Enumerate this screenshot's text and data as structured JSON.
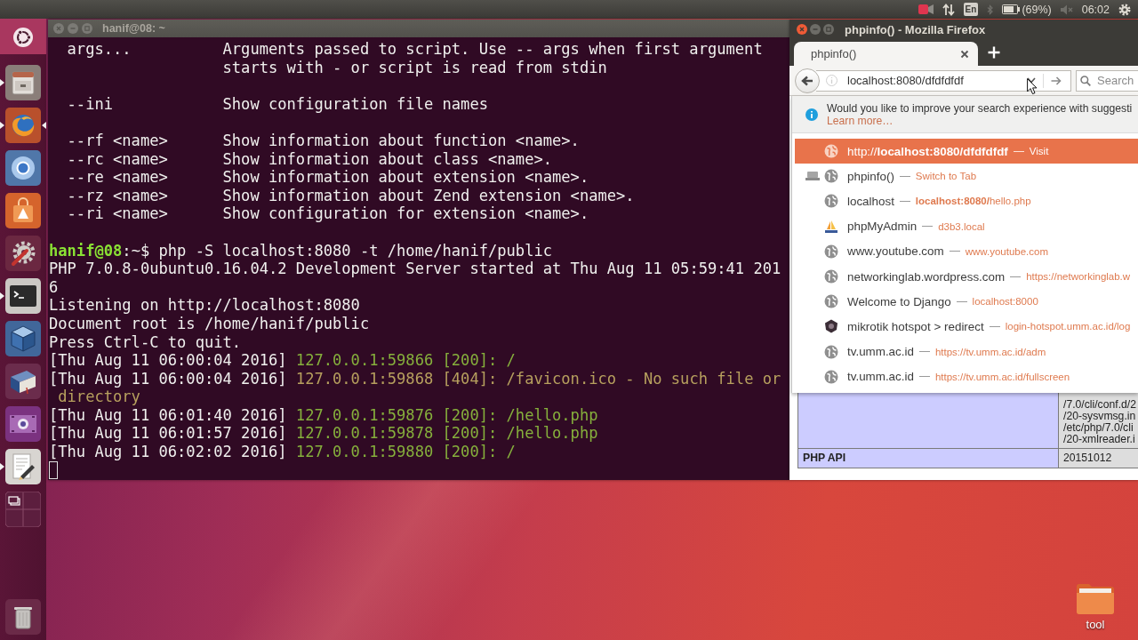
{
  "top_panel": {
    "keyboard_layout": "En",
    "battery": "(69%)",
    "clock": "06:02"
  },
  "launcher": {
    "apps": [
      {
        "running": true,
        "focused": false
      },
      {
        "running": true,
        "focused": true
      },
      {
        "running": false,
        "focused": false
      },
      {
        "running": false,
        "focused": false
      },
      {
        "running": false,
        "focused": false
      },
      {
        "running": true,
        "focused": false
      },
      {
        "running": false,
        "focused": false
      },
      {
        "running": false,
        "focused": false
      },
      {
        "running": false,
        "focused": false
      },
      {
        "running": true,
        "focused": false
      },
      {
        "running": false,
        "focused": false
      }
    ]
  },
  "terminal": {
    "title": "hanif@08: ~",
    "help_sections": [
      {
        "options": [
          {
            "option": "args...",
            "description": [
              "Arguments passed to script. Use -- args when first argument",
              "starts with - or script is read from stdin"
            ]
          }
        ]
      },
      {
        "options": [
          {
            "option": "--ini",
            "description": [
              "Show configuration file names"
            ]
          }
        ]
      },
      {
        "options": [
          {
            "option": "--rf <name>",
            "description": [
              "Show information about function <name>."
            ]
          },
          {
            "option": "--rc <name>",
            "description": [
              "Show information about class <name>."
            ]
          },
          {
            "option": "--re <name>",
            "description": [
              "Show information about extension <name>."
            ]
          },
          {
            "option": "--rz <name>",
            "description": [
              "Show information about Zend extension <name>."
            ]
          },
          {
            "option": "--ri <name>",
            "description": [
              "Show configuration for extension <name>."
            ]
          }
        ]
      }
    ],
    "session": [
      {
        "kind": "prompt",
        "user": "hanif@08",
        "path": ":~$",
        "command": "php -S localhost:8080 -t /home/hanif/public"
      },
      {
        "kind": "text",
        "text": "PHP 7.0.8-0ubuntu0.16.04.2 Development Server started at Thu Aug 11 05:59:41 201"
      },
      {
        "kind": "text",
        "text": "6"
      },
      {
        "kind": "text",
        "text": "Listening on http://localhost:8080"
      },
      {
        "kind": "text",
        "text": "Document root is /home/hanif/public"
      },
      {
        "kind": "text",
        "text": "Press Ctrl-C to quit."
      },
      {
        "kind": "log",
        "time": "[Thu Aug 11 06:00:04 2016]",
        "request": "127.0.0.1:59866 [200]: /",
        "color": "#86b03c"
      },
      {
        "kind": "log",
        "time": "[Thu Aug 11 06:00:04 2016]",
        "request": "127.0.0.1:59868 [404]: /favicon.ico - No such file or",
        "color": "#b7a05e"
      },
      {
        "kind": "wrap",
        "text": "directory",
        "color": "#b7a05e"
      },
      {
        "kind": "log",
        "time": "[Thu Aug 11 06:01:40 2016]",
        "request": "127.0.0.1:59876 [200]: /hello.php",
        "color": "#86b03c"
      },
      {
        "kind": "log",
        "time": "[Thu Aug 11 06:01:57 2016]",
        "request": "127.0.0.1:59878 [200]: /hello.php",
        "color": "#86b03c"
      },
      {
        "kind": "log",
        "time": "[Thu Aug 11 06:02:02 2016]",
        "request": "127.0.0.1:59880 [200]: /",
        "color": "#86b03c"
      }
    ]
  },
  "firefox": {
    "title": "phpinfo() - Mozilla Firefox",
    "tabs": [
      {
        "label": "phpinfo()",
        "selected": true
      }
    ],
    "url": "localhost:8080/dfdfdfdf",
    "search_placeholder": "Search",
    "notice": {
      "text": "Would you like to improve your search experience with suggesti",
      "link": "Learn more…"
    },
    "suggestions": [
      {
        "kind": "globe",
        "title": "http://**localhost:8080/dfdfdfdf**",
        "detail": "Visit",
        "selected": true,
        "open_tab": false
      },
      {
        "kind": "globe",
        "title": "phpinfo()",
        "detail": "Switch to Tab",
        "selected": false,
        "open_tab": true
      },
      {
        "kind": "globe",
        "title": "localhost",
        "detail": "**localhost:8080/**hello.php",
        "selected": false,
        "open_tab": false
      },
      {
        "kind": "sails",
        "title": "phpMyAdmin",
        "detail": "d3b3.local",
        "selected": false,
        "open_tab": false
      },
      {
        "kind": "globe",
        "title": "www.youtube.com",
        "detail": "www.youtube.com",
        "selected": false,
        "open_tab": false
      },
      {
        "kind": "globe",
        "title": "networkinglab.wordpress.com",
        "detail": "https://networkinglab.w",
        "selected": false,
        "open_tab": false
      },
      {
        "kind": "globe",
        "title": "Welcome to Django",
        "detail": "localhost:8000",
        "selected": false,
        "open_tab": false
      },
      {
        "kind": "badge",
        "title": "mikrotik hotspot > redirect",
        "detail": "login-hotspot.umm.ac.id/log",
        "selected": false,
        "open_tab": false
      },
      {
        "kind": "globe",
        "title": "tv.umm.ac.id",
        "detail": "https://tv.umm.ac.id/adm",
        "selected": false,
        "open_tab": false
      },
      {
        "kind": "globe",
        "title": "tv.umm.ac.id",
        "detail": "https://tv.umm.ac.id/fullscreen",
        "selected": false,
        "open_tab": false
      }
    ],
    "page_table": {
      "rows": [
        {
          "value_lines": [
            "/7.0/cli/conf.d/2",
            "/20-sysvmsg.in",
            "/etc/php/7.0/cli",
            "/20-xmlreader.i"
          ]
        },
        {
          "label": "PHP API",
          "value_lines": [
            "20151012"
          ]
        }
      ]
    }
  },
  "desktop": {
    "icons": [
      {
        "label": "tool"
      }
    ]
  }
}
